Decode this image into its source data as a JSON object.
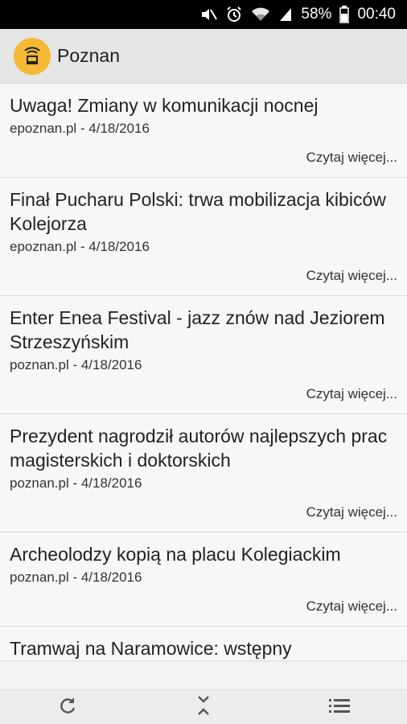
{
  "status": {
    "battery": "58%",
    "time": "00:40"
  },
  "app": {
    "title": "Poznan"
  },
  "articles": [
    {
      "title": "Uwaga! Zmiany w komunikacji nocnej",
      "meta": "epoznan.pl - 4/18/2016",
      "more": "Czytaj więcej..."
    },
    {
      "title": "Finał Pucharu Polski: trwa mobilizacja kibiców Kolejorza",
      "meta": "epoznan.pl - 4/18/2016",
      "more": "Czytaj więcej..."
    },
    {
      "title": "Enter Enea Festival - jazz znów nad Jeziorem Strzeszyńskim",
      "meta": "poznan.pl - 4/18/2016",
      "more": "Czytaj więcej..."
    },
    {
      "title": "Prezydent nagrodził autorów najlepszych prac magisterskich i doktorskich",
      "meta": "poznan.pl - 4/18/2016",
      "more": "Czytaj więcej..."
    },
    {
      "title": "Archeolodzy kopią na placu Kolegiackim",
      "meta": "poznan.pl - 4/18/2016",
      "more": "Czytaj więcej..."
    },
    {
      "title": "Tramwaj na Naramowice: wstępny",
      "meta": "",
      "more": ""
    }
  ],
  "icons": {
    "status": [
      "mute-icon",
      "alarm-icon",
      "wifi-icon",
      "signal-icon",
      "battery-icon"
    ],
    "app": "rss-logo-icon",
    "bottom": [
      "refresh-icon",
      "collapse-icon",
      "list-icon"
    ]
  },
  "colors": {
    "logo": "#f5b935",
    "statusBar": "#000000",
    "appBar": "#e6e6e6"
  }
}
